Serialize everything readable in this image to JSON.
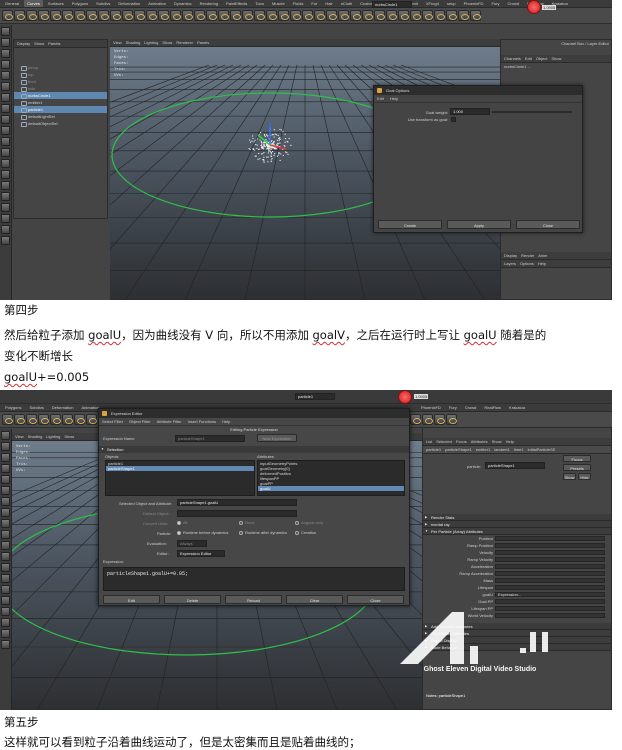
{
  "screenshot1": {
    "menu_tabs": [
      "General",
      "Curves",
      "Surfaces",
      "Polygons",
      "Subdivs",
      "Deformation",
      "Animation",
      "Dynamics",
      "Rendering",
      "PaintEffects",
      "Toon",
      "Muscle",
      "Fluids",
      "Fur",
      "Hair",
      "nCloth",
      "Custom",
      "DMM",
      "Pulldownit",
      "XFrog4",
      "seup",
      "PhoenixFD",
      "Fury",
      "Crowd",
      "RealFlow",
      "Krakatoa"
    ],
    "active_tab": "Curves",
    "top_field": "nurbsCircle1",
    "viewport_menu": [
      "View",
      "Shading",
      "Lighting",
      "Show",
      "Renderer",
      "Panels"
    ],
    "outliner_menu": [
      "Display",
      "Show",
      "Panels"
    ],
    "outliner_items": [
      {
        "label": "persp",
        "state": "dim"
      },
      {
        "label": "top",
        "state": "dim"
      },
      {
        "label": "front",
        "state": "dim"
      },
      {
        "label": "side",
        "state": "dim"
      },
      {
        "label": "nurbsCircle1",
        "state": "sel"
      },
      {
        "label": "emitter1",
        "state": "normal"
      },
      {
        "label": "particle1",
        "state": "sel"
      },
      {
        "label": "defaultLightSet",
        "state": "normal"
      },
      {
        "label": "defaultObjectSet",
        "state": "normal"
      }
    ],
    "hud_rows": [
      "Verts:",
      "Edges:",
      "Faces:",
      "Tris:",
      "UVs:"
    ],
    "dialog": {
      "title": "Goal Options",
      "menu": [
        "Edit",
        "Help"
      ],
      "goal_weight_label": "Goal weight:",
      "goal_weight_value": "1.000",
      "use_transform_label": "Use transform as goal:",
      "buttons": [
        "Create",
        "Apply",
        "Close"
      ]
    },
    "channel_box": {
      "header": "Channel Box / Layer Editor",
      "menu": [
        "Channels",
        "Edit",
        "Object",
        "Show"
      ],
      "object_name": "nurbsCircle1 ...",
      "layer_tabs": [
        "Display",
        "Render",
        "Anim"
      ],
      "layer_menu": [
        "Layers",
        "Options",
        "Help"
      ]
    },
    "counter": "1.0905"
  },
  "step4": {
    "heading": "第四步",
    "line1_parts": [
      "然后给粒子添加 ",
      "goalU",
      "，因为曲线没有 V 向，所以不用添加 ",
      "goalV",
      "，之后在运行时上写让 ",
      "goalU",
      " 随着是的"
    ],
    "line2": "变化不断增长",
    "line3_parts": [
      "goalU",
      "+=0.005"
    ]
  },
  "screenshot2": {
    "menu_tabs": [
      "Polygons",
      "Subdivs",
      "Deformation",
      "Animation"
    ],
    "right_tabs": [
      "PhoenixFD",
      "Fury",
      "Crowd",
      "RealFlow",
      "Krakatoa"
    ],
    "top_field": "particle1",
    "counter": "1.0905",
    "viewport_menu": [
      "View",
      "Shading",
      "Lighting",
      "Show"
    ],
    "hud_rows": [
      "Verts:",
      "Edges:",
      "Faces:",
      "Tris:",
      "UVs:"
    ],
    "expression_editor": {
      "title": "Expression Editor",
      "menu": [
        "Select Filter",
        "Object Filter",
        "Attribute Filter",
        "Insert Functions",
        "Help"
      ],
      "mode_title": "Editing Particle Expression",
      "expression_name_label": "Expression Name",
      "expression_name_value": "particleShape1",
      "new_expression": "New Expression",
      "selection_header": "Selection",
      "objects_label": "Objects",
      "attributes_label": "Attributes",
      "objects": [
        {
          "label": "particle1",
          "sel": false
        },
        {
          "label": "particleShape1",
          "sel": true
        }
      ],
      "attributes": [
        {
          "label": "inputGeometryPoints",
          "sel": false
        },
        {
          "label": "goalGeometry[0]",
          "sel": false
        },
        {
          "label": "deformedPosition",
          "sel": false
        },
        {
          "label": "lifespanPP",
          "sel": false
        },
        {
          "label": "goalPP",
          "sel": false
        },
        {
          "label": "goalU",
          "sel": true
        }
      ],
      "selected_label": "Selected Object and Attribute:",
      "selected_value": "particleShape1.goalU",
      "default_object_label": "Default Object:",
      "convert_units_label": "Convert Units:",
      "convert_units_opts": [
        "All",
        "None",
        "Angular only"
      ],
      "particle_label": "Particle:",
      "particle_opts": [
        "Runtime before dynamics",
        "Runtime after dynamics",
        "Creation"
      ],
      "evaluation_label": "Evaluation:",
      "evaluation_value": "Always",
      "editor_label": "Editor:",
      "editor_value": "Expression Editor",
      "expression_label": "Expression:",
      "expression_text": "particleShape1.goalU+=0.05;",
      "buttons": [
        "Edit",
        "Delete",
        "Reload",
        "Clear",
        "Close"
      ]
    },
    "attr_editor": {
      "tabs": [
        "List",
        "Selected",
        "Focus",
        "Attributes",
        "Show",
        "Help"
      ],
      "node_tabs": [
        "particle1",
        "particleShape1",
        "emitter1",
        "lambert1",
        "time1",
        "initialParticleSE"
      ],
      "shape_label": "particle:",
      "shape_value": "particleShape1",
      "focus": "Focus",
      "presets": "Presets",
      "show": "Show",
      "hide": "Hide",
      "sections": [
        {
          "label": "Render Stats",
          "open": false
        },
        {
          "label": "mental ray",
          "open": false
        },
        {
          "label": "Per Particle (Array) Attributes",
          "open": true
        }
      ],
      "rows": [
        "Position",
        "Ramp Position",
        "Velocity",
        "Ramp Velocity",
        "Acceleration",
        "Ramp Acceleration",
        "Mass",
        "Lifespan",
        "goalU",
        "Goal PP",
        "Lifespan PP",
        "World Velocity"
      ],
      "goalu_value": "Expression...",
      "bottom_sections": [
        "Add Dynamic Attributes",
        "Clip Effects Attributes",
        "Object Display",
        "Node Behavior"
      ],
      "notes": "Notes: particleShape1"
    },
    "watermark": "Ghost Eleven Digital Video Studio"
  },
  "step5": {
    "heading": "第五步",
    "line1": "这样就可以看到粒子沿着曲线运动了，但是太密集而且是贴着曲线的；"
  }
}
